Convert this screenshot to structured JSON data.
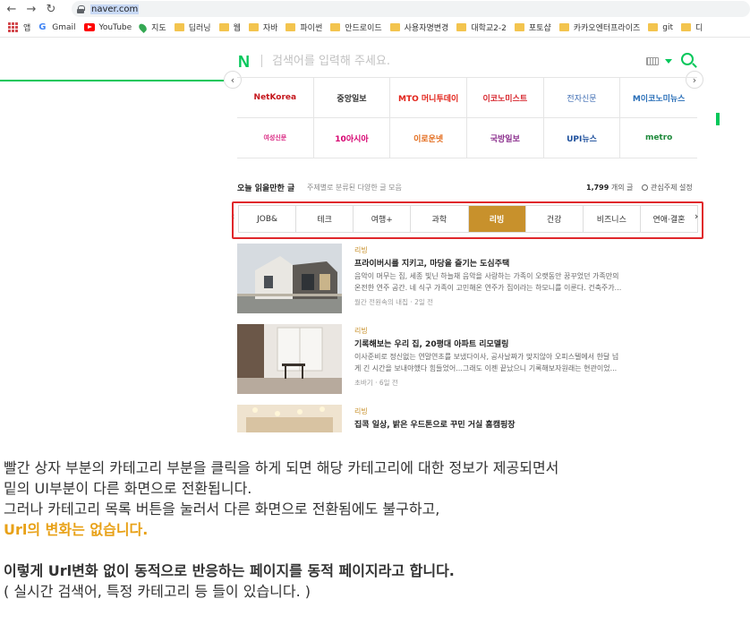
{
  "browser": {
    "url": "naver.com",
    "bookmarks": [
      "앱",
      "Gmail",
      "YouTube",
      "지도",
      "딥러닝",
      "웹",
      "자바",
      "파이썬",
      "안드로이드",
      "사용자명변경",
      "대학교2-2",
      "포토샵",
      "카카오엔터프라이즈",
      "git",
      "디"
    ]
  },
  "naver": {
    "logo": "N",
    "search_placeholder": "검색어를 입력해 주세요.",
    "press": [
      {
        "name": "NetKorea",
        "color": "#c4161c"
      },
      {
        "name": "중앙일보",
        "color": "#333333"
      },
      {
        "name": "MTO 머니투데이",
        "color": "#e2231a"
      },
      {
        "name": "이코노미스트",
        "color": "#d7282f"
      },
      {
        "name": "전자신문",
        "color": "#3f6db3"
      },
      {
        "name": "M이코노미뉴스",
        "color": "#2a6fb8"
      },
      {
        "name": "여성신문",
        "color": "#d92480"
      },
      {
        "name": "10아시아",
        "color": "#d6006f"
      },
      {
        "name": "이로운넷",
        "color": "#e36c1d"
      },
      {
        "name": "국방일보",
        "color": "#8a2d8c"
      },
      {
        "name": "UPI뉴스",
        "color": "#1d4f9c"
      },
      {
        "name": "metro",
        "color": "#1f8a3c"
      }
    ],
    "today": {
      "title": "오늘 읽을만한 글",
      "desc": "주제별로 분류된 다양한 글 모음",
      "count_num": "1,799",
      "count_unit": "개의 글",
      "interest": "관심주제 설정"
    },
    "tabs": [
      "JOB&",
      "테크",
      "여행+",
      "과학",
      "리빙",
      "건강",
      "비즈니스",
      "연애·결혼"
    ],
    "active_tab": "리빙",
    "articles": [
      {
        "category": "리빙",
        "title": "프라이버시를 지키고, 마당을 즐기는 도심주택",
        "desc": "음악이 머무는 집, 세종 빛닌 하늘채 음악을 사랑하는 가족이 오랫동안 꿈꾸었던 가족만의\n온전한 연주 공간. 네 식구 가족이 고민해온 연주가 집이라는 하모니를 이룬다. 건축주가...",
        "meta": "월간 전원속의 내집 · 2일 전"
      },
      {
        "category": "리빙",
        "title": "기록해보는 우리 집, 20평대 아파트 리모델링",
        "desc": "이사준비로 정신없는 연말연초를 보냈다이사, 공사날짜가 맞지않아 오피스텔에서 한달 넘\n게 긴 시간을 보내야했다 힘들었어...그래도 이젠 끝났으니 기록해보자원래는 현관이었...",
        "meta": "초바기 · 6일 전"
      },
      {
        "category": "리빙",
        "title": "집콕 일상, 밝은 우드톤으로 꾸민 거실 홈캠핑장",
        "desc": "",
        "meta": ""
      }
    ]
  },
  "explanation": {
    "line1": "빨간 상자 부분의 카테고리 부분을 클릭을 하게 되면 해당 카테고리에 대한 정보가 제공되면서",
    "line2": "밑의 UI부분이 다른 화면으로 전환됩니다.",
    "line3": "그러나 카테고리 목록 버튼을 눌러서 다른 화면으로 전환됨에도 불구하고,",
    "line4": "Url의 변화는 없습니다.",
    "line5": "이렇게 Url변화 없이 동적으로 반응하는 페이지를 동적 페이지라고 합니다.",
    "line6": "( 실시간 검색어, 특정 카테고리 등 들이 있습니다. )",
    "highlight_color": "#e8a117"
  }
}
